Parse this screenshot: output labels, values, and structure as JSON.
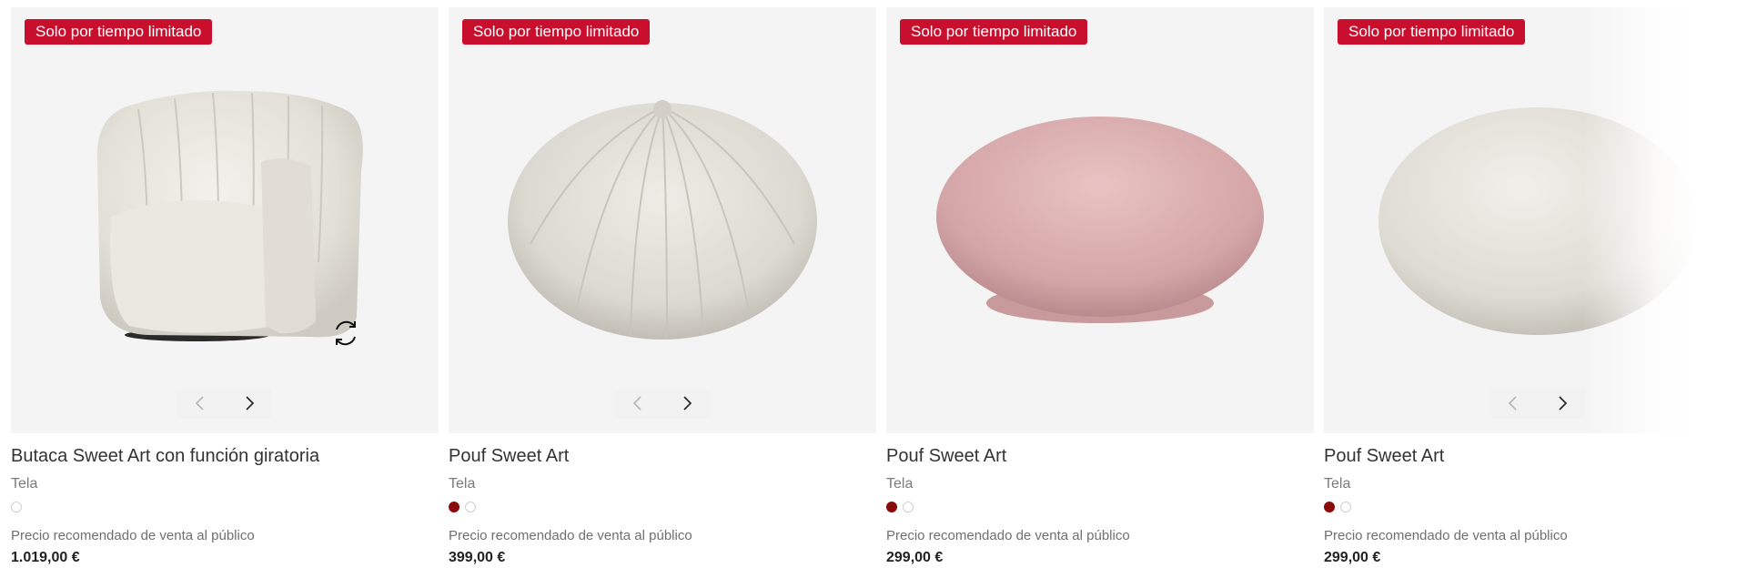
{
  "products": [
    {
      "badge": "Solo por tiempo limitado",
      "name": "Butaca Sweet Art con función giratoria",
      "material": "Tela",
      "price_label": "Precio recomendado de venta al público",
      "price": "1.019,00 €",
      "swatches": [
        "#ffffff"
      ],
      "image": "armchair",
      "has_rotate_icon": true,
      "has_gallery_nav": true
    },
    {
      "badge": "Solo por tiempo limitado",
      "name": "Pouf Sweet Art",
      "material": "Tela",
      "price_label": "Precio recomendado de venta al público",
      "price": "399,00 €",
      "swatches": [
        "#8b0a0a",
        "#ffffff"
      ],
      "image": "pouf-ribbed",
      "has_rotate_icon": false,
      "has_gallery_nav": true
    },
    {
      "badge": "Solo por tiempo limitado",
      "name": "Pouf Sweet Art",
      "material": "Tela",
      "price_label": "Precio recomendado de venta al público",
      "price": "299,00 €",
      "swatches": [
        "#8b0a0a",
        "#ffffff"
      ],
      "image": "pouf-pink",
      "has_rotate_icon": false,
      "has_gallery_nav": false
    },
    {
      "badge": "Solo por tiempo limitado",
      "name": "Pouf Sweet Art",
      "material": "Tela",
      "price_label": "Precio recomendado de venta al público",
      "price": "299,00 €",
      "swatches": [
        "#8b0a0a",
        "#ffffff"
      ],
      "image": "pouf-white",
      "has_rotate_icon": false,
      "has_gallery_nav": true
    }
  ],
  "icons": {
    "prev": "chevron-left-icon",
    "next": "chevron-right-icon",
    "rotate": "rotate-360-icon"
  },
  "colors": {
    "badge": "#c8102e",
    "card_bg": "#f4f4f4"
  }
}
